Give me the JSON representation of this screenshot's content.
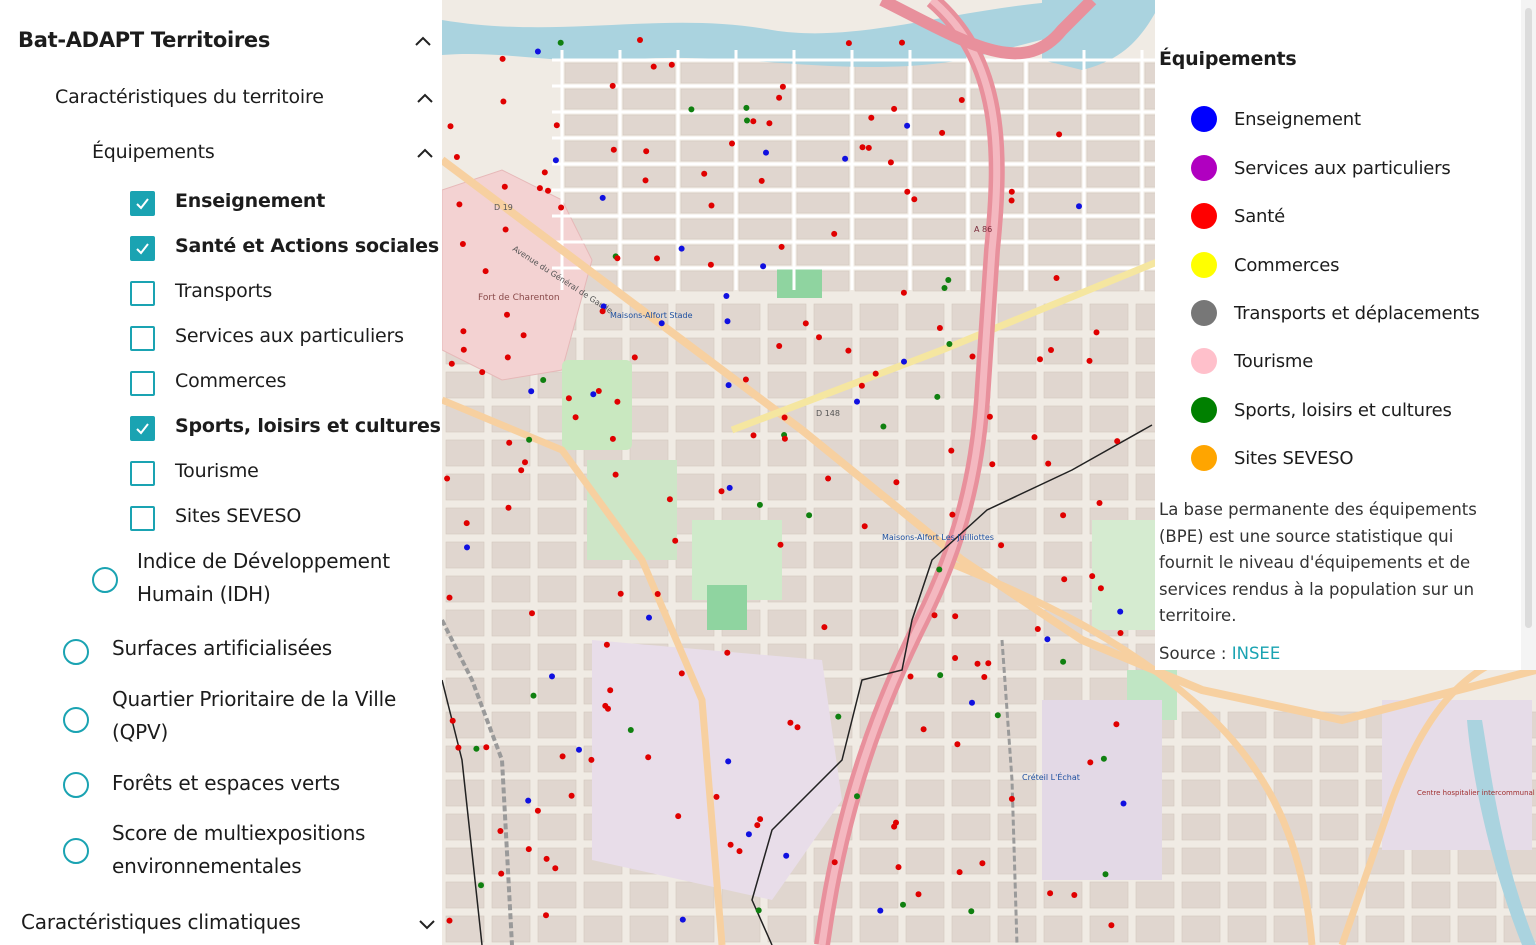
{
  "sidebar": {
    "title": "Bat-ADAPT Territoires",
    "section": "Caractéristiques du territoire",
    "subsection": "Équipements",
    "checkboxes": [
      {
        "label": "Enseignement",
        "checked": true
      },
      {
        "label": "Santé et Actions sociales",
        "checked": true
      },
      {
        "label": "Transports",
        "checked": false
      },
      {
        "label": "Services aux particuliers",
        "checked": false
      },
      {
        "label": "Commerces",
        "checked": false
      },
      {
        "label": "Sports, loisirs et cultures",
        "checked": true
      },
      {
        "label": "Tourisme",
        "checked": false
      },
      {
        "label": "Sites SEVESO",
        "checked": false
      }
    ],
    "idh": {
      "line1": "Indice de Développement",
      "line2": "Humain (IDH)"
    },
    "layers": [
      {
        "line1": "Surfaces artificialisées",
        "line2": ""
      },
      {
        "line1": "Quartier Prioritaire de la Ville",
        "line2": "(QPV)"
      },
      {
        "line1": "Forêts et espaces verts",
        "line2": ""
      },
      {
        "line1": "Score de multiexpositions",
        "line2": "environnementales"
      }
    ],
    "footer_section": "Caractéristiques climatiques"
  },
  "legend": {
    "title": "Équipements",
    "items": [
      {
        "label": "Enseignement",
        "color": "#0000ff"
      },
      {
        "label": "Services aux particuliers",
        "color": "#b000c0"
      },
      {
        "label": "Santé",
        "color": "#ff0000"
      },
      {
        "label": "Commerces",
        "color": "#ffff00"
      },
      {
        "label": "Transports et déplacements",
        "color": "#777777"
      },
      {
        "label": "Tourisme",
        "color": "#ffc0cb"
      },
      {
        "label": "Sports, loisirs et cultures",
        "color": "#008000"
      },
      {
        "label": "Sites SEVESO",
        "color": "#ffa500"
      }
    ],
    "description": "La base permanente des équipements (BPE) est une source statistique qui fournit le niveau d'équipements et de services rendus à la population sur un territoire.",
    "source_prefix": "Source : ",
    "source_link": "INSEE"
  },
  "map": {
    "labels": {
      "fort": "Fort de Charenton",
      "station_top": "Maisons-Alfort Stade",
      "station_bottom": "Maisons-Alfort Les Juilliottes",
      "avenue": "Avenue du Général de Gaulle",
      "a86": "A 86",
      "d19": "D 19",
      "d148": "D 148",
      "creteil": "Créteil L'Échat",
      "hospital": "Centre hospitalier intercommunal de Créteil"
    }
  }
}
